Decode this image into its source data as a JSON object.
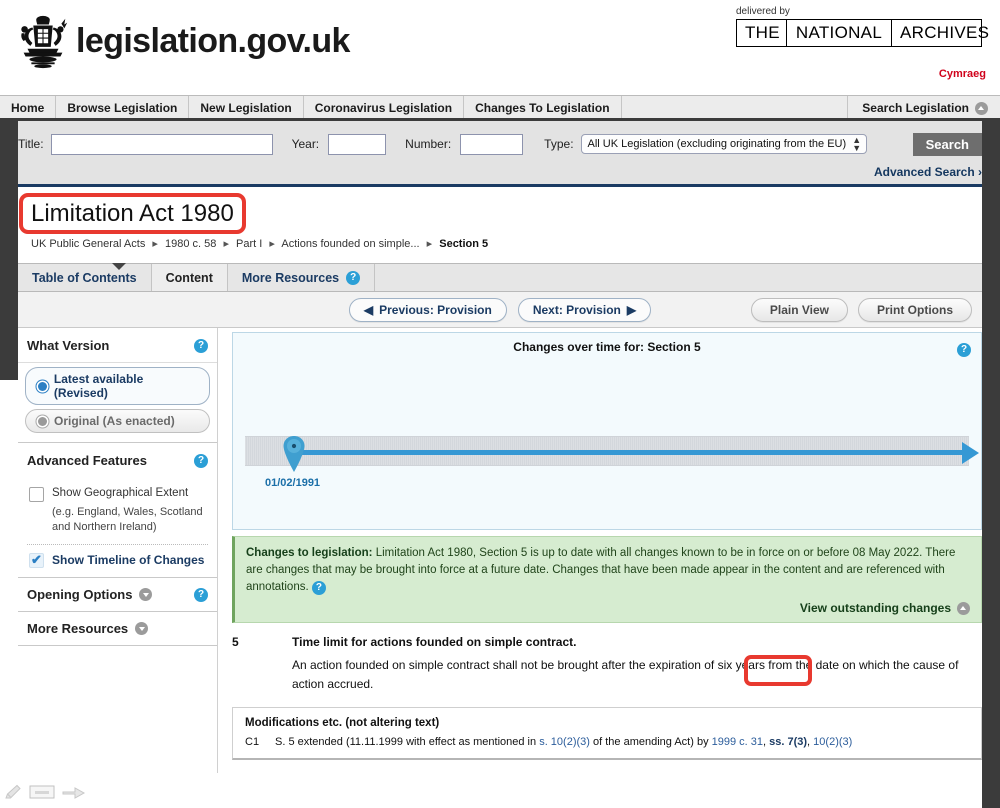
{
  "masthead": {
    "brand_name": "legislation.gov.uk",
    "crest_icon": "royal-coat-of-arms",
    "delivered_by_label": "delivered by",
    "tna": {
      "the": "THE",
      "national": "NATIONAL",
      "archives": "ARCHIVES"
    },
    "cymraeg": "Cymraeg"
  },
  "nav": {
    "items": [
      "Home",
      "Browse Legislation",
      "New Legislation",
      "Coronavirus Legislation",
      "Changes To Legislation"
    ],
    "search_legislation": "Search Legislation",
    "search_legislation_icon": "chevron-up-circle-icon"
  },
  "search": {
    "title_label": "Title:",
    "title_value": "",
    "year_label": "Year:",
    "year_value": "",
    "number_label": "Number:",
    "number_value": "",
    "type_label": "Type:",
    "type_selected": "All UK Legislation (excluding originating from the EU)",
    "search_button": "Search",
    "advanced_search": "Advanced Search ›"
  },
  "document": {
    "title": "Limitation Act 1980",
    "breadcrumb": [
      "UK Public General Acts",
      "1980 c. 58",
      "Part I",
      "Actions founded on simple...",
      "Section 5"
    ]
  },
  "tabs": {
    "items": [
      {
        "label": "Table of Contents",
        "active": false
      },
      {
        "label": "Content",
        "active": true
      },
      {
        "label": "More Resources",
        "active": false
      }
    ],
    "help_icon": "question-mark-icon"
  },
  "toolbar": {
    "previous": "Previous: Provision",
    "next": "Next: Provision",
    "plain_view": "Plain View",
    "print_options": "Print Options",
    "prev_icon": "left-triangle-icon",
    "next_icon": "right-triangle-icon"
  },
  "sidebar": {
    "what_version": {
      "heading": "What Version",
      "help_icon": "question-mark-icon",
      "options": [
        {
          "label": "Latest available (Revised)",
          "selected": true
        },
        {
          "label": "Original (As enacted)",
          "selected": false
        }
      ]
    },
    "advanced_features": {
      "heading": "Advanced Features",
      "help_icon": "question-mark-icon",
      "geo_extent_label": "Show Geographical Extent",
      "geo_extent_sub": "(e.g. England, Wales, Scotland and Northern Ireland)",
      "geo_extent_checked": false,
      "timeline_label": "Show Timeline of Changes",
      "timeline_checked": true
    },
    "opening_options": {
      "label": "Opening Options",
      "toggle_icon": "chevron-down-circle-icon",
      "help_icon": "question-mark-icon"
    },
    "more_resources": {
      "label": "More Resources",
      "toggle_icon": "chevron-down-circle-icon"
    }
  },
  "timeline": {
    "title": "Changes over time for: Section 5",
    "help_icon": "question-mark-icon",
    "pin_icon": "map-pin-icon",
    "arrow_icon": "right-arrow-icon",
    "points": [
      {
        "date": "01/02/1991"
      }
    ]
  },
  "changes_notice": {
    "heading": "Changes to legislation:",
    "body": "Limitation Act 1980, Section 5 is up to date with all changes known to be in force on or before 08 May 2022. There are changes that may be brought into force at a future date. Changes that have been made appear in the content and are referenced with annotations.",
    "help_icon": "question-mark-icon",
    "view_outstanding": "View outstanding changes",
    "view_outstanding_icon": "chevron-down-circle-icon"
  },
  "section": {
    "number": "5",
    "heading": "Time limit for actions founded on simple contract.",
    "text_before": "An action founded on simple contract shall not be brought after the expiration of ",
    "highlight": "six years",
    "text_after": " from the date on which the cause of action accrued."
  },
  "modifications": {
    "title": "Modifications etc. (not altering text)",
    "rows": [
      {
        "key": "C1",
        "p1": "S. 5 extended (11.11.1999 with effect as mentioned in ",
        "link1": "s. 10(2)(3)",
        "p2": " of the amending Act) by ",
        "link2": "1999 c. 31",
        "p3": ", ",
        "link3": "ss. 7(3)",
        "p4": ", ",
        "link4": "10(2)(3)"
      }
    ]
  },
  "annotation_tools": {
    "pen_icon": "pen-icon",
    "rectangle_icon": "rectangle-icon",
    "arrow_icon": "arrow-cursor-icon"
  },
  "colors": {
    "highlight_red": "#e8392f",
    "accent_blue": "#3598d4",
    "link_blue": "#1b3b63",
    "notice_green_bg": "#d6ecd0",
    "nav_grey": "#ececec"
  }
}
